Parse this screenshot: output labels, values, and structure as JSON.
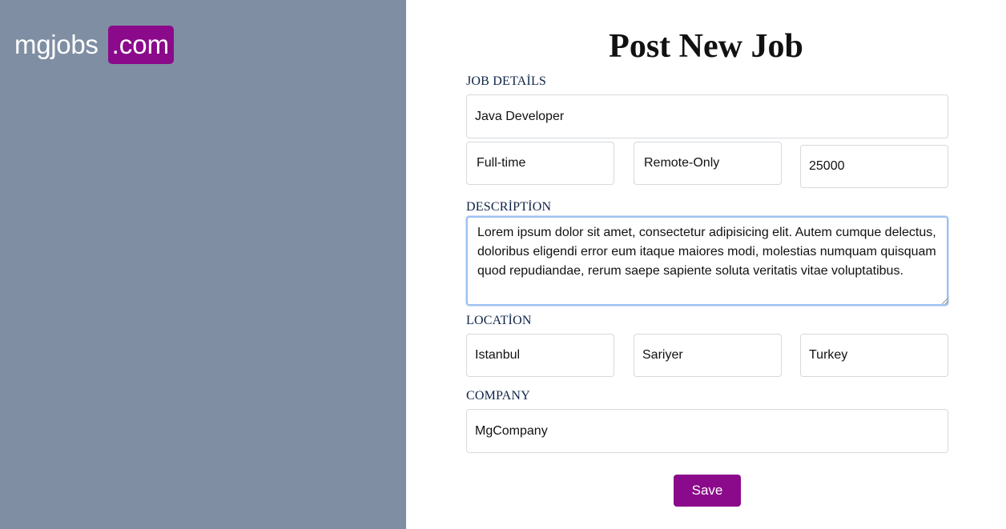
{
  "logo": {
    "name": "mgjobs",
    "tld": ".com"
  },
  "page": {
    "title": "Post New Job"
  },
  "job_details": {
    "label": "JOB DETAİLS",
    "title_value": "Java Developer",
    "type_value": "Full-time",
    "remote_value": "Remote-Only",
    "salary_value": "25000"
  },
  "description": {
    "label": "DESCRİPTİON",
    "value": "Lorem ipsum dolor sit amet, consectetur adipisicing elit. Autem cumque delectus, doloribus eligendi error eum itaque maiores modi, molestias numquam quisquam quod repudiandae, rerum saepe sapiente soluta veritatis vitae voluptatibus."
  },
  "location": {
    "label": "LOCATİON",
    "city_value": "Istanbul",
    "district_value": "Sariyer",
    "country_value": "Turkey"
  },
  "company": {
    "label": "COMPANY",
    "name_value": "MgCompany"
  },
  "actions": {
    "save_label": "Save"
  },
  "colors": {
    "sidebar_bg": "#7f8ea3",
    "brand_accent": "#8b0a8b",
    "label_text": "#0d2347",
    "focus_border": "#9ec1f0"
  }
}
